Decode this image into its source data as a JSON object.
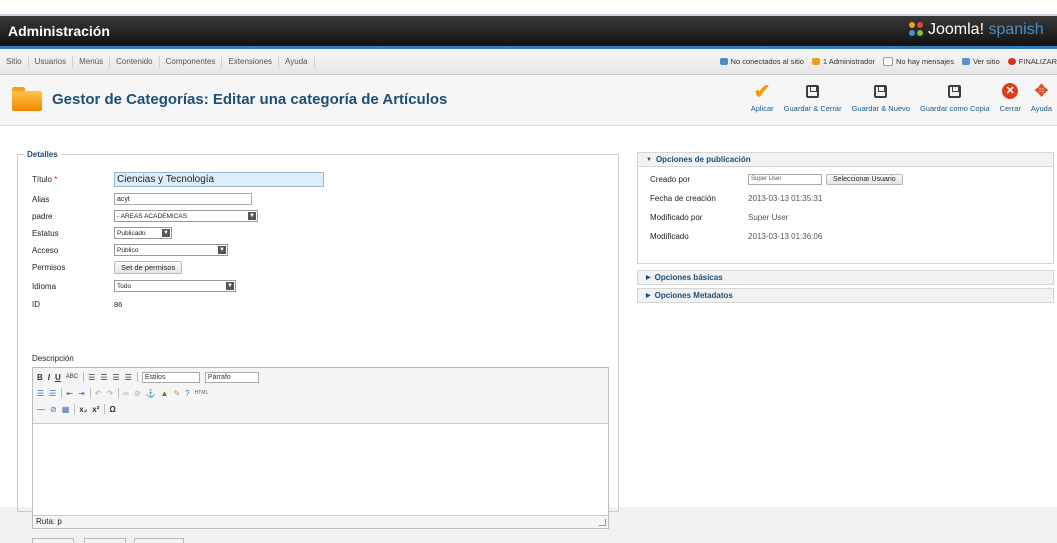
{
  "header": {
    "title": "Administración",
    "brand": "Joomla!",
    "brand_suffix": "spanish"
  },
  "menu": [
    "Sitio",
    "Usuarios",
    "Menús",
    "Contenido",
    "Componentes",
    "Extensiones",
    "Ayuda"
  ],
  "status": {
    "visitors": "No conectados al sitio",
    "admins": "1 Administrador",
    "messages": "No hay mensajes",
    "view_site": "Ver sitio",
    "logout": "FINALIZAR"
  },
  "toolbar": {
    "page_title": "Gestor de Categorías: Editar una categoría de Artículos",
    "apply": "Aplicar",
    "save_close": "Guardar & Cerrar",
    "save_new": "Guardar & Nuevo",
    "save_copy": "Guardar como Copia",
    "close": "Cerrar",
    "help": "Ayuda"
  },
  "details": {
    "legend": "Detalles",
    "title_label": "Título",
    "title_value": "Ciencias y Tecnología",
    "alias_label": "Alias",
    "alias_value": "acyt",
    "parent_label": "padre",
    "parent_value": "- AREAS ACADEMICAS",
    "status_label": "Estatus",
    "status_value": "Publicado",
    "access_label": "Acceso",
    "access_value": "Público",
    "perms_label": "Permisos",
    "perms_button": "Set de permisos",
    "lang_label": "Idioma",
    "lang_value": "Todo",
    "id_label": "ID",
    "id_value": "86",
    "desc_label": "Descripción"
  },
  "editor": {
    "styles": "Estilos",
    "format": "Párrafo",
    "path": "Ruta: p"
  },
  "publishing": {
    "header": "Opciones de publicación",
    "created_by_label": "Creado por",
    "created_by_value": "Super User",
    "select_user_button": "Seleccionar Usuario",
    "created_date_label": "Fecha de creación",
    "created_date_value": "2013-03-13 01:35:31",
    "modified_by_label": "Modificado por",
    "modified_by_value": "Super User",
    "modified_label": "Modificado",
    "modified_value": "2013-03-13 01:36:06"
  },
  "basic_options": "Opciones básicas",
  "metadata_options": "Opciones Metadatos"
}
